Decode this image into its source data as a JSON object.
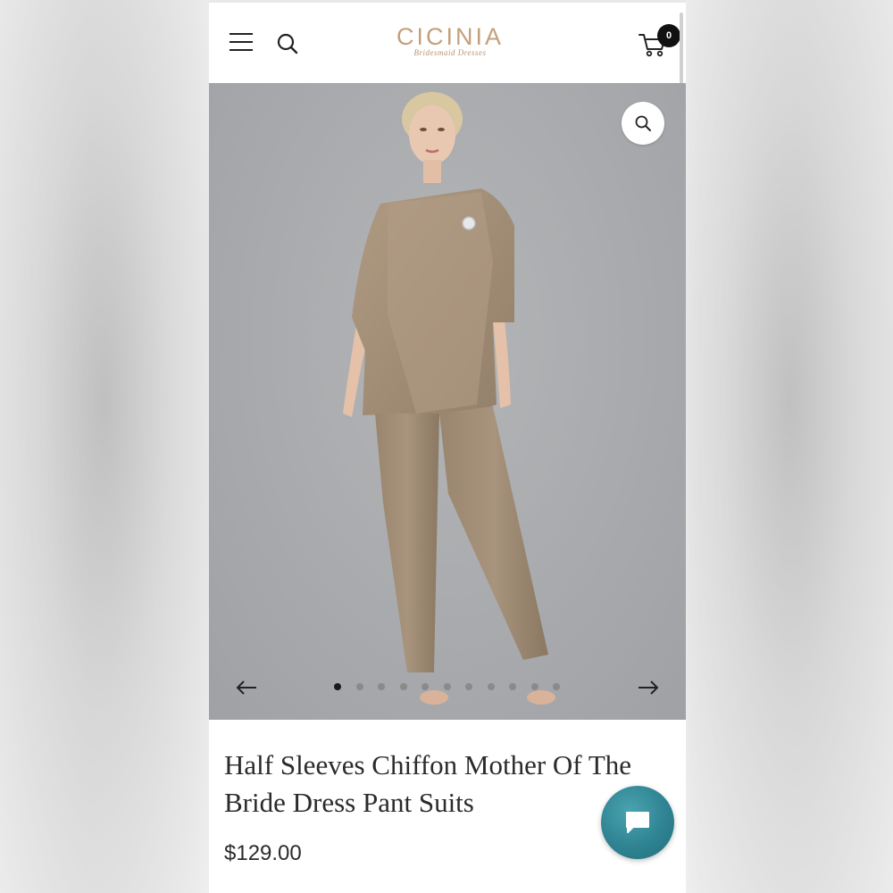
{
  "header": {
    "logo_main": "CICINIA",
    "logo_sub": "Bridesmaid Dresses",
    "cart_count": "0"
  },
  "gallery": {
    "slide_count": 11,
    "active_slide": 1,
    "image_alt": "Woman in taupe half sleeves chiffon pant suit"
  },
  "product": {
    "title": "Half Sleeves Chiffon Mother Of The Bride Dress Pant Suits",
    "price": "$129.00"
  },
  "colors": {
    "brand_gold": "#c4a07a",
    "chat_teal": "#2f8392",
    "dress_taupe": "#a38c74"
  },
  "icons": [
    "menu-icon",
    "search-icon",
    "cart-icon",
    "zoom-icon",
    "arrow-left-icon",
    "arrow-right-icon",
    "chat-icon"
  ]
}
